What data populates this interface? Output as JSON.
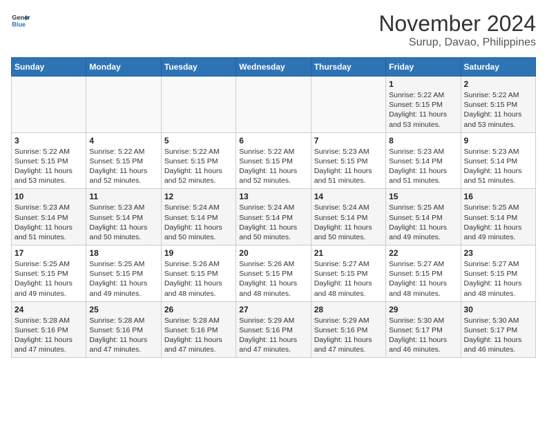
{
  "header": {
    "logo_line1": "General",
    "logo_line2": "Blue",
    "title": "November 2024",
    "subtitle": "Surup, Davao, Philippines"
  },
  "days_of_week": [
    "Sunday",
    "Monday",
    "Tuesday",
    "Wednesday",
    "Thursday",
    "Friday",
    "Saturday"
  ],
  "weeks": [
    [
      {
        "day": "",
        "sunrise": "",
        "sunset": "",
        "daylight": ""
      },
      {
        "day": "",
        "sunrise": "",
        "sunset": "",
        "daylight": ""
      },
      {
        "day": "",
        "sunrise": "",
        "sunset": "",
        "daylight": ""
      },
      {
        "day": "",
        "sunrise": "",
        "sunset": "",
        "daylight": ""
      },
      {
        "day": "",
        "sunrise": "",
        "sunset": "",
        "daylight": ""
      },
      {
        "day": "1",
        "sunrise": "Sunrise: 5:22 AM",
        "sunset": "Sunset: 5:15 PM",
        "daylight": "Daylight: 11 hours and 53 minutes."
      },
      {
        "day": "2",
        "sunrise": "Sunrise: 5:22 AM",
        "sunset": "Sunset: 5:15 PM",
        "daylight": "Daylight: 11 hours and 53 minutes."
      }
    ],
    [
      {
        "day": "3",
        "sunrise": "Sunrise: 5:22 AM",
        "sunset": "Sunset: 5:15 PM",
        "daylight": "Daylight: 11 hours and 53 minutes."
      },
      {
        "day": "4",
        "sunrise": "Sunrise: 5:22 AM",
        "sunset": "Sunset: 5:15 PM",
        "daylight": "Daylight: 11 hours and 52 minutes."
      },
      {
        "day": "5",
        "sunrise": "Sunrise: 5:22 AM",
        "sunset": "Sunset: 5:15 PM",
        "daylight": "Daylight: 11 hours and 52 minutes."
      },
      {
        "day": "6",
        "sunrise": "Sunrise: 5:22 AM",
        "sunset": "Sunset: 5:15 PM",
        "daylight": "Daylight: 11 hours and 52 minutes."
      },
      {
        "day": "7",
        "sunrise": "Sunrise: 5:23 AM",
        "sunset": "Sunset: 5:15 PM",
        "daylight": "Daylight: 11 hours and 51 minutes."
      },
      {
        "day": "8",
        "sunrise": "Sunrise: 5:23 AM",
        "sunset": "Sunset: 5:14 PM",
        "daylight": "Daylight: 11 hours and 51 minutes."
      },
      {
        "day": "9",
        "sunrise": "Sunrise: 5:23 AM",
        "sunset": "Sunset: 5:14 PM",
        "daylight": "Daylight: 11 hours and 51 minutes."
      }
    ],
    [
      {
        "day": "10",
        "sunrise": "Sunrise: 5:23 AM",
        "sunset": "Sunset: 5:14 PM",
        "daylight": "Daylight: 11 hours and 51 minutes."
      },
      {
        "day": "11",
        "sunrise": "Sunrise: 5:23 AM",
        "sunset": "Sunset: 5:14 PM",
        "daylight": "Daylight: 11 hours and 50 minutes."
      },
      {
        "day": "12",
        "sunrise": "Sunrise: 5:24 AM",
        "sunset": "Sunset: 5:14 PM",
        "daylight": "Daylight: 11 hours and 50 minutes."
      },
      {
        "day": "13",
        "sunrise": "Sunrise: 5:24 AM",
        "sunset": "Sunset: 5:14 PM",
        "daylight": "Daylight: 11 hours and 50 minutes."
      },
      {
        "day": "14",
        "sunrise": "Sunrise: 5:24 AM",
        "sunset": "Sunset: 5:14 PM",
        "daylight": "Daylight: 11 hours and 50 minutes."
      },
      {
        "day": "15",
        "sunrise": "Sunrise: 5:25 AM",
        "sunset": "Sunset: 5:14 PM",
        "daylight": "Daylight: 11 hours and 49 minutes."
      },
      {
        "day": "16",
        "sunrise": "Sunrise: 5:25 AM",
        "sunset": "Sunset: 5:14 PM",
        "daylight": "Daylight: 11 hours and 49 minutes."
      }
    ],
    [
      {
        "day": "17",
        "sunrise": "Sunrise: 5:25 AM",
        "sunset": "Sunset: 5:15 PM",
        "daylight": "Daylight: 11 hours and 49 minutes."
      },
      {
        "day": "18",
        "sunrise": "Sunrise: 5:25 AM",
        "sunset": "Sunset: 5:15 PM",
        "daylight": "Daylight: 11 hours and 49 minutes."
      },
      {
        "day": "19",
        "sunrise": "Sunrise: 5:26 AM",
        "sunset": "Sunset: 5:15 PM",
        "daylight": "Daylight: 11 hours and 48 minutes."
      },
      {
        "day": "20",
        "sunrise": "Sunrise: 5:26 AM",
        "sunset": "Sunset: 5:15 PM",
        "daylight": "Daylight: 11 hours and 48 minutes."
      },
      {
        "day": "21",
        "sunrise": "Sunrise: 5:27 AM",
        "sunset": "Sunset: 5:15 PM",
        "daylight": "Daylight: 11 hours and 48 minutes."
      },
      {
        "day": "22",
        "sunrise": "Sunrise: 5:27 AM",
        "sunset": "Sunset: 5:15 PM",
        "daylight": "Daylight: 11 hours and 48 minutes."
      },
      {
        "day": "23",
        "sunrise": "Sunrise: 5:27 AM",
        "sunset": "Sunset: 5:15 PM",
        "daylight": "Daylight: 11 hours and 48 minutes."
      }
    ],
    [
      {
        "day": "24",
        "sunrise": "Sunrise: 5:28 AM",
        "sunset": "Sunset: 5:16 PM",
        "daylight": "Daylight: 11 hours and 47 minutes."
      },
      {
        "day": "25",
        "sunrise": "Sunrise: 5:28 AM",
        "sunset": "Sunset: 5:16 PM",
        "daylight": "Daylight: 11 hours and 47 minutes."
      },
      {
        "day": "26",
        "sunrise": "Sunrise: 5:28 AM",
        "sunset": "Sunset: 5:16 PM",
        "daylight": "Daylight: 11 hours and 47 minutes."
      },
      {
        "day": "27",
        "sunrise": "Sunrise: 5:29 AM",
        "sunset": "Sunset: 5:16 PM",
        "daylight": "Daylight: 11 hours and 47 minutes."
      },
      {
        "day": "28",
        "sunrise": "Sunrise: 5:29 AM",
        "sunset": "Sunset: 5:16 PM",
        "daylight": "Daylight: 11 hours and 47 minutes."
      },
      {
        "day": "29",
        "sunrise": "Sunrise: 5:30 AM",
        "sunset": "Sunset: 5:17 PM",
        "daylight": "Daylight: 11 hours and 46 minutes."
      },
      {
        "day": "30",
        "sunrise": "Sunrise: 5:30 AM",
        "sunset": "Sunset: 5:17 PM",
        "daylight": "Daylight: 11 hours and 46 minutes."
      }
    ]
  ]
}
